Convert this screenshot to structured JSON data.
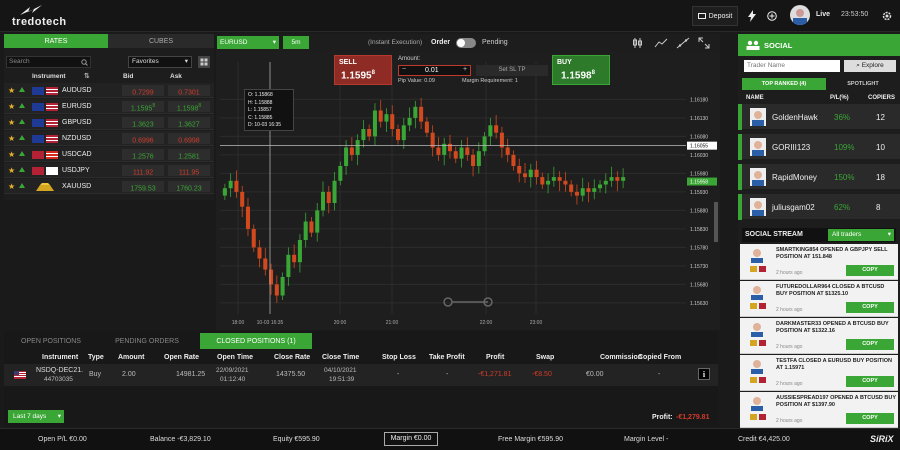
{
  "brand": {
    "logo_text": "tredotech",
    "footer_brand": "SiRiX"
  },
  "topbar": {
    "deposit_label": "Deposit",
    "mode_label": "Live",
    "time": "23:53:50"
  },
  "rates_panel": {
    "tab_rates": "RATES",
    "tab_cubes": "CUBES",
    "search_placeholder": "Search",
    "filter_value": "Favorites",
    "col_instrument": "Instrument",
    "col_bid": "Bid",
    "col_ask": "Ask",
    "rows": [
      {
        "symbol": "AUDUSD",
        "bid": "0.7299",
        "bid_sup": "",
        "ask": "0.7301",
        "ask_sup": "",
        "dir": "dn"
      },
      {
        "symbol": "EURUSD",
        "bid": "1.1595",
        "bid_sup": "8",
        "ask": "1.1598",
        "ask_sup": "8",
        "dir": "up"
      },
      {
        "symbol": "GBPUSD",
        "bid": "1.3623",
        "bid_sup": "",
        "ask": "1.3627",
        "ask_sup": "",
        "dir": "up"
      },
      {
        "symbol": "NZDUSD",
        "bid": "0.6996",
        "bid_sup": "",
        "ask": "0.6998",
        "ask_sup": "",
        "dir": "dn"
      },
      {
        "symbol": "USDCAD",
        "bid": "1.2576",
        "bid_sup": "",
        "ask": "1.2581",
        "ask_sup": "",
        "dir": "up"
      },
      {
        "symbol": "USDJPY",
        "bid": "111.92",
        "bid_sup": "",
        "ask": "111.95",
        "ask_sup": "",
        "dir": "dn"
      },
      {
        "symbol": "XAUUSD",
        "bid": "1759.53",
        "bid_sup": "",
        "ask": "1760.23",
        "ask_sup": "",
        "dir": "up"
      }
    ]
  },
  "chart_toolbar": {
    "symbol": "EURUSD",
    "interval": "5m",
    "exec_label": "(Instant Execution)",
    "order_label": "Order",
    "pending_label": "Pending"
  },
  "order_ticket": {
    "sell_label": "SELL",
    "sell_price": "1.1595",
    "sell_sup": "8",
    "buy_label": "BUY",
    "buy_price": "1.1598",
    "buy_sup": "8",
    "amount_label": "Amount:",
    "amount_value": "0.01",
    "sltp_label": "Set SL TP",
    "pip_value": "Pip Value: 0.09",
    "margin_req": "Margin Requirement: 1"
  },
  "ohlc": {
    "o": "O: 1.15868",
    "h": "H: 1.15888",
    "l": "L: 1.15857",
    "c": "C: 1.15885",
    "d": "D: 10-03 16:35"
  },
  "chart_data": {
    "type": "candlestick",
    "y_ticks": [
      "1.16180",
      "1.16130",
      "1.16080",
      "1.16030",
      "1.15980",
      "1.15930",
      "1.15880",
      "1.15830",
      "1.15780",
      "1.15730",
      "1.15680",
      "1.15630"
    ],
    "x_ticks": [
      "18:00",
      "10-03 16:35",
      "20:00",
      "21:00",
      "22:00",
      "23:00"
    ],
    "last_price": "1.15958",
    "crosshair_price": "1.16055",
    "ylim": [
      1.156,
      1.162
    ],
    "closes": [
      1.1594,
      1.1596,
      1.1593,
      1.1589,
      1.1583,
      1.1578,
      1.1575,
      1.1572,
      1.1568,
      1.1565,
      1.157,
      1.1576,
      1.1574,
      1.158,
      1.1585,
      1.1582,
      1.1588,
      1.1593,
      1.159,
      1.1596,
      1.16,
      1.1605,
      1.1603,
      1.1607,
      1.161,
      1.1608,
      1.1615,
      1.1612,
      1.1614,
      1.161,
      1.1607,
      1.1611,
      1.1613,
      1.1616,
      1.1612,
      1.1609,
      1.1605,
      1.1603,
      1.1606,
      1.1604,
      1.1602,
      1.1605,
      1.1603,
      1.16,
      1.1604,
      1.1608,
      1.1611,
      1.1609,
      1.1605,
      1.1603,
      1.16,
      1.1598,
      1.1597,
      1.1599,
      1.1597,
      1.1595,
      1.1596,
      1.1597,
      1.1596,
      1.1595,
      1.1593,
      1.1592,
      1.1594,
      1.1593,
      1.1594,
      1.1595,
      1.1596,
      1.1597,
      1.1596,
      1.1597
    ]
  },
  "bottom_panel": {
    "tab_open": "OPEN POSITIONS",
    "tab_pending": "PENDING ORDERS",
    "tab_closed": "CLOSED POSITIONS (1)",
    "headers": [
      "Instrument",
      "Type",
      "Amount",
      "Open Rate",
      "Open Time",
      "Close Rate",
      "Close Time",
      "Stop Loss",
      "Take Profit",
      "Profit",
      "Swap",
      "Commission",
      "Copied From"
    ],
    "row": {
      "instrument": "NSDQ-DEC21.",
      "id": "44703035",
      "type": "Buy",
      "amount": "2.00",
      "open_rate": "14981.25",
      "open_date": "22/09/2021",
      "open_clock": "01:12:40",
      "close_rate": "14375.50",
      "close_date": "04/10/2021",
      "close_clock": "19:51:39",
      "stop_loss": "-",
      "take_profit": "-",
      "profit": "-€1,271.81",
      "swap": "-€8.50",
      "commission": "€0.00",
      "copied_from": "-"
    },
    "period": "Last 7 days",
    "profit_label": "Profit:",
    "profit_value": "-€1,279.81"
  },
  "social": {
    "title": "SOCIAL",
    "search_placeholder": "Trader Name",
    "explore": "Explore",
    "tab_top": "TOP RANKED (4)",
    "tab_spotlight": "SPOTLIGHT",
    "col_name": "NAME",
    "col_pl": "P/L(%)",
    "col_copiers": "COPIERS",
    "traders": [
      {
        "name": "GoldenHawk",
        "pl": "36%",
        "copiers": "12"
      },
      {
        "name": "GORIII123",
        "pl": "109%",
        "copiers": "10"
      },
      {
        "name": "RapidMoney",
        "pl": "150%",
        "copiers": "18"
      },
      {
        "name": "juliusgam02",
        "pl": "62%",
        "copiers": "8"
      }
    ],
    "stream_title": "SOCIAL STREAM",
    "stream_filter": "All traders",
    "stream": [
      {
        "text": "SMARTKING854 OPENED A GBPJPY SELL POSITION AT 151.848",
        "time": "2 hours ago",
        "copy": "COPY"
      },
      {
        "text": "FUTUREDOLLAR964 CLOSED A BTCUSD BUY POSITION AT $1325.10",
        "time": "2 hours ago",
        "copy": "COPY"
      },
      {
        "text": "DARKMASTER33 OPENED A BTCUSD BUY POSITION AT $1322.16",
        "time": "2 hours ago",
        "copy": "COPY"
      },
      {
        "text": "TESTFA CLOSED A EURUSD BUY POSITION AT 1.15971",
        "time": "2 hours ago",
        "copy": "COPY"
      },
      {
        "text": "AUSSIESPREAD197 OPENED A BTCUSD BUY POSITION AT $1397.90",
        "time": "2 hours ago",
        "copy": "COPY"
      }
    ]
  },
  "footer": {
    "open_pl": "Open P/L €0.00",
    "balance": "Balance -€3,829.10",
    "equity": "Equity €595.90",
    "margin": "Margin €0.00",
    "free_margin": "Free Margin €595.90",
    "margin_level": "Margin Level -",
    "credit": "Credit €4,425.00"
  },
  "colors": {
    "accent": "#3aa635",
    "sell": "#c0392b",
    "up": "#3aa635",
    "down": "#d23b2c"
  }
}
